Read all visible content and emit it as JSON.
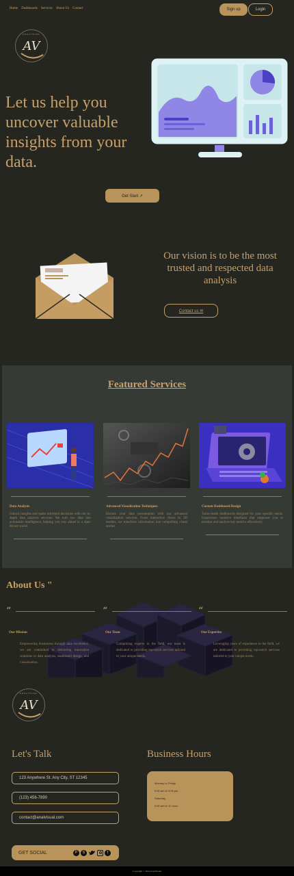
{
  "nav": {
    "links": [
      "Home",
      "Dashboards",
      "Services",
      "About Us",
      "Contact"
    ],
    "signup": "Sign up",
    "login": "Login"
  },
  "logo": {
    "monogram": "AV",
    "brand": "ANALYSUAL"
  },
  "hero": {
    "title": "Let us help you uncover valuable insights from your data.",
    "cta": "Get Start ↗"
  },
  "vision": {
    "text": "Our vision is to be the most trusted and respected data analysis",
    "cta": "Contact us ✉"
  },
  "services": {
    "title": "Featured Services",
    "items": [
      {
        "title": "Data Analysis",
        "desc": "Unlock insights and make informed decisions with our in-depth data analysis services. We turn raw data into actionable intelligence, helping you stay ahead in a data-driven world."
      },
      {
        "title": "Advanced Visualization Techniques",
        "desc": "Elevate your data presentation with our advanced visualization services. From interactive charts to 3D models, we transform information into compelling visual stories."
      },
      {
        "title": "Custom Dashboard Design",
        "desc": "Tailor-made dashboards designed for your specific needs. Experience intuitive interfaces that empower you to monitor and analyze key metrics effortlessly."
      }
    ]
  },
  "about": {
    "title": "About Us \"",
    "items": [
      {
        "quote": "“",
        "title": "Our Mission",
        "text": "Empowering businesses through data excellence, we are committed to delivering innovative solutions in data analysis, dashboard design, and visualization."
      },
      {
        "quote": "“",
        "title": "Our Team",
        "text": "Comprising experts in the field, our team is dedicated to providing top-notch services tailored to your unique needs."
      },
      {
        "quote": "“",
        "title": "Our Expertise",
        "text": "Leveraging years of experience in the field, we are dedicated to providing top-notch services tailored to your unique needs."
      }
    ]
  },
  "contact": {
    "title": "Let's Talk",
    "address": "123 Anywhere St. Any City, ST 12345",
    "phone": "(123) 456-7890",
    "email": "contact@analvisual.com",
    "social_label": "GET SOCIAL",
    "social_icons": [
      "pinterest-icon",
      "skype-icon",
      "twitter-icon",
      "instagram-icon",
      "facebook-icon"
    ]
  },
  "hours": {
    "title": "Business Hours",
    "lines": [
      "Monday to Friday",
      "9:00 am to 9:00 pm",
      "Saturday",
      "9:00 am to 12 noon"
    ]
  },
  "footer": {
    "copyright": "Copyright © 2024 AnalVisual"
  }
}
